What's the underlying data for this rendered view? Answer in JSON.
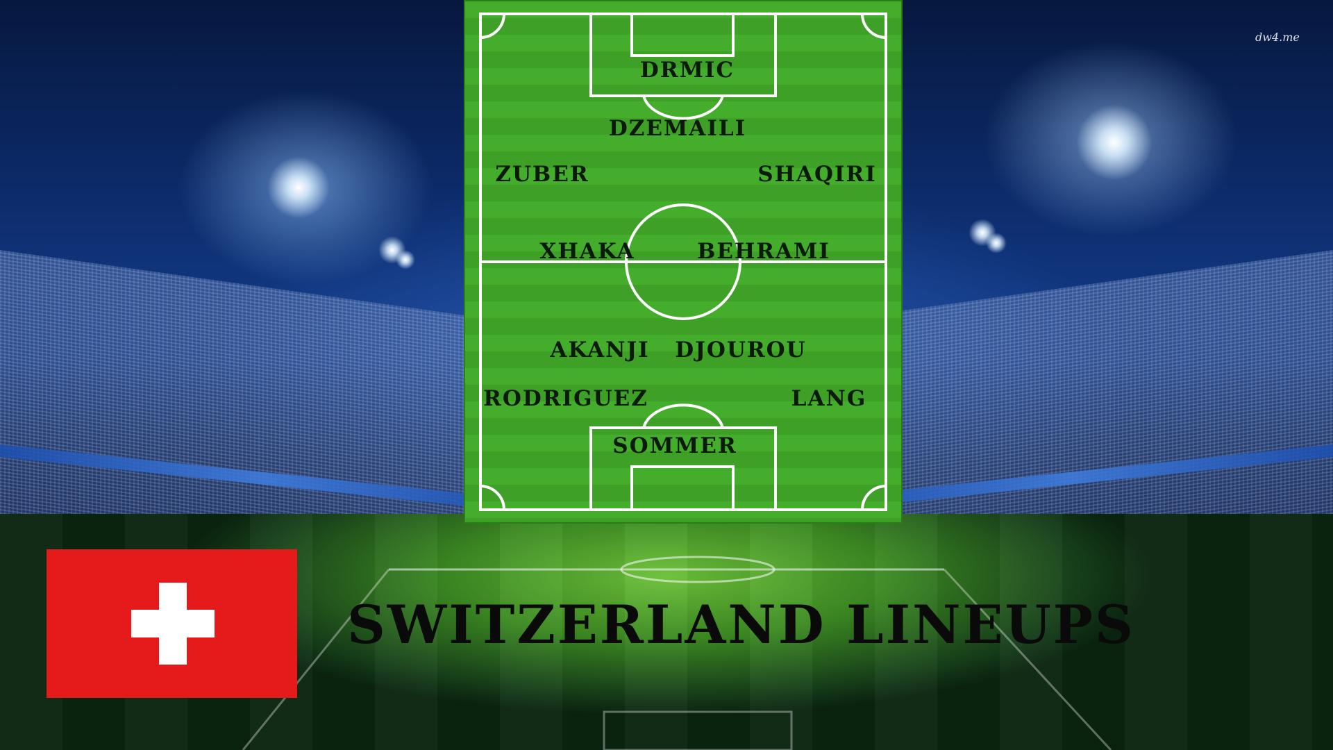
{
  "watermark": "dw4.me",
  "title": "SWITZERLAND LINEUPS",
  "flag": {
    "background": "#e51b1b",
    "cross": "#ffffff"
  },
  "lineup": {
    "players": [
      {
        "name": "DRMIC"
      },
      {
        "name": "DZEMAILI"
      },
      {
        "name": "ZUBER"
      },
      {
        "name": "SHAQIRI"
      },
      {
        "name": "XHAKA"
      },
      {
        "name": "BEHRAMI"
      },
      {
        "name": "AKANJI"
      },
      {
        "name": "DJOUROU"
      },
      {
        "name": "RODRIGUEZ"
      },
      {
        "name": "LANG"
      },
      {
        "name": "SOMMER"
      }
    ]
  },
  "colors": {
    "pitch_green": "#45ad2c",
    "pitch_lines": "#ffffff",
    "text": "#0b1a0b"
  }
}
